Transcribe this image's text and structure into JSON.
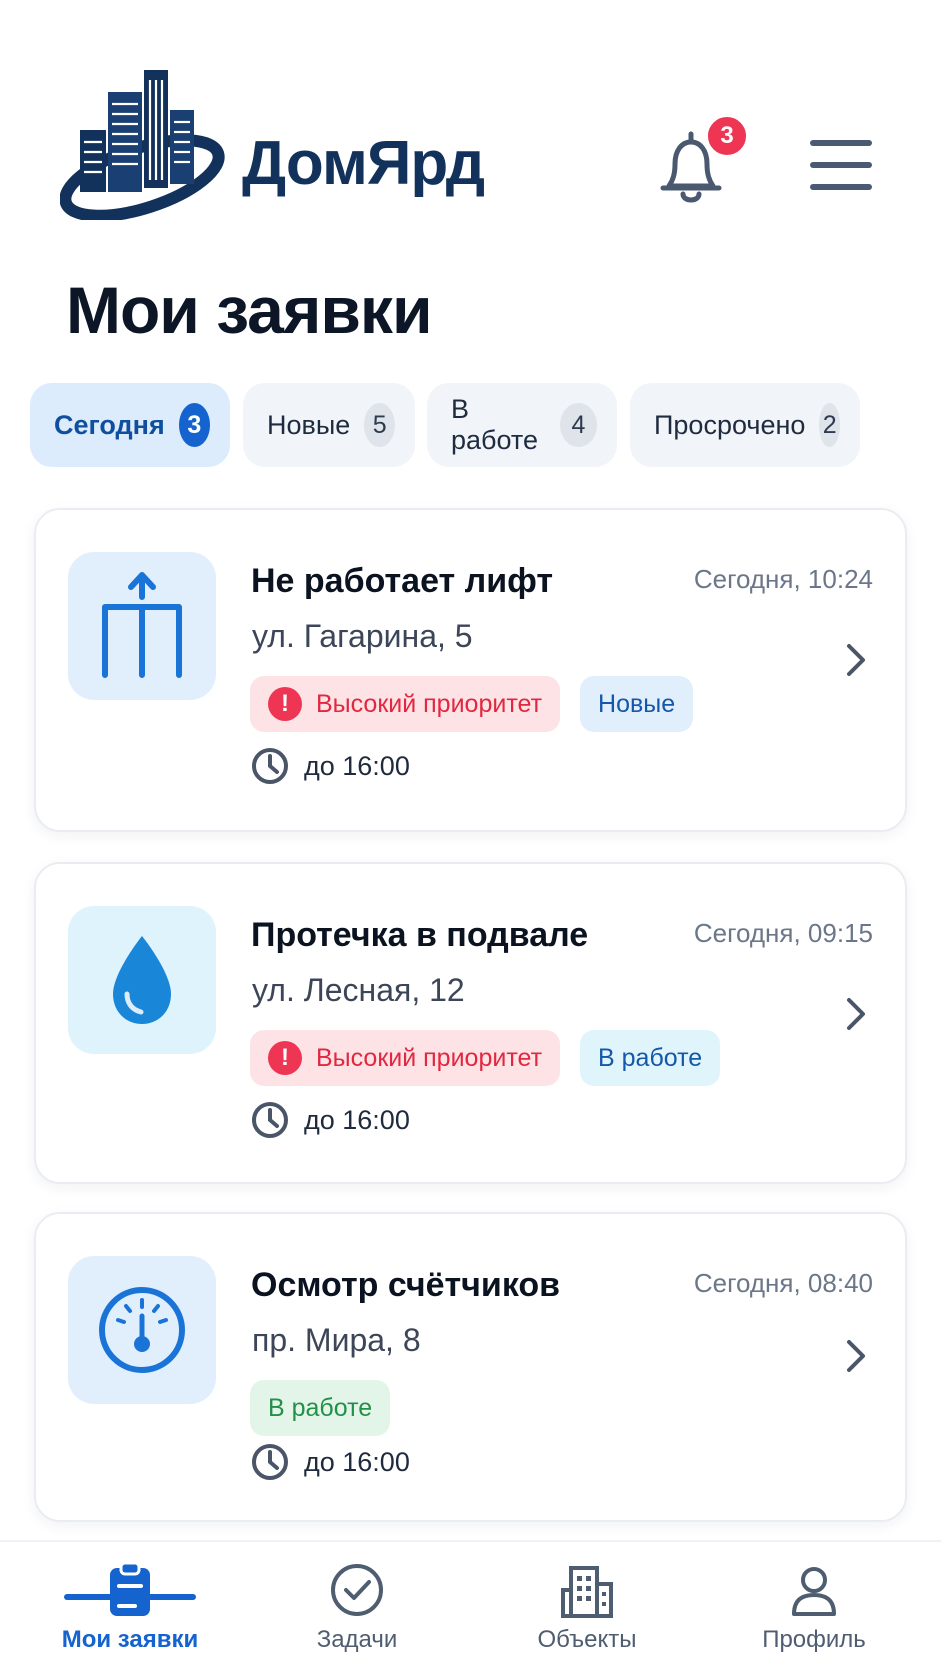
{
  "header": {
    "brand": "ДомЯрд",
    "notifications_count": "3"
  },
  "page_title": "Мои заявки",
  "filters": [
    {
      "label": "Сегодня",
      "count": "3",
      "active": true
    },
    {
      "label": "Новые",
      "count": "5",
      "active": false
    },
    {
      "label": "В работе",
      "count": "4",
      "active": false
    },
    {
      "label": "Просрочено",
      "count": "2",
      "active": false
    }
  ],
  "requests": [
    {
      "icon": "elevator-icon",
      "title": "Не работает лифт",
      "time": "Сегодня, 10:24",
      "address": "ул. Гагарина, 5",
      "priority": "Высокий приоритет",
      "status": "Новые",
      "due": "до 16:00"
    },
    {
      "icon": "water-drop-icon",
      "title": "Протечка в подвале",
      "time": "Сегодня, 09:15",
      "address": "ул. Лесная, 12",
      "priority": "Высокий приоритет",
      "status": "В работе",
      "due": "до 16:00"
    },
    {
      "icon": "meter-gauge-icon",
      "title": "Осмотр счётчиков",
      "time": "Сегодня, 08:40",
      "address": "пр. Мира, 8",
      "status": "В работе",
      "due": "до 16:00"
    }
  ],
  "bottom_nav": [
    {
      "label": "Мои заявки",
      "icon": "clipboard-icon",
      "active": true
    },
    {
      "label": "Задачи",
      "icon": "check-circle-icon",
      "active": false
    },
    {
      "label": "Объекты",
      "icon": "building-icon",
      "active": false
    },
    {
      "label": "Профиль",
      "icon": "user-icon",
      "active": false
    }
  ],
  "colors": {
    "brand": "#12325c",
    "accent": "#1463cf",
    "danger": "#ee3553",
    "success": "#239048"
  }
}
